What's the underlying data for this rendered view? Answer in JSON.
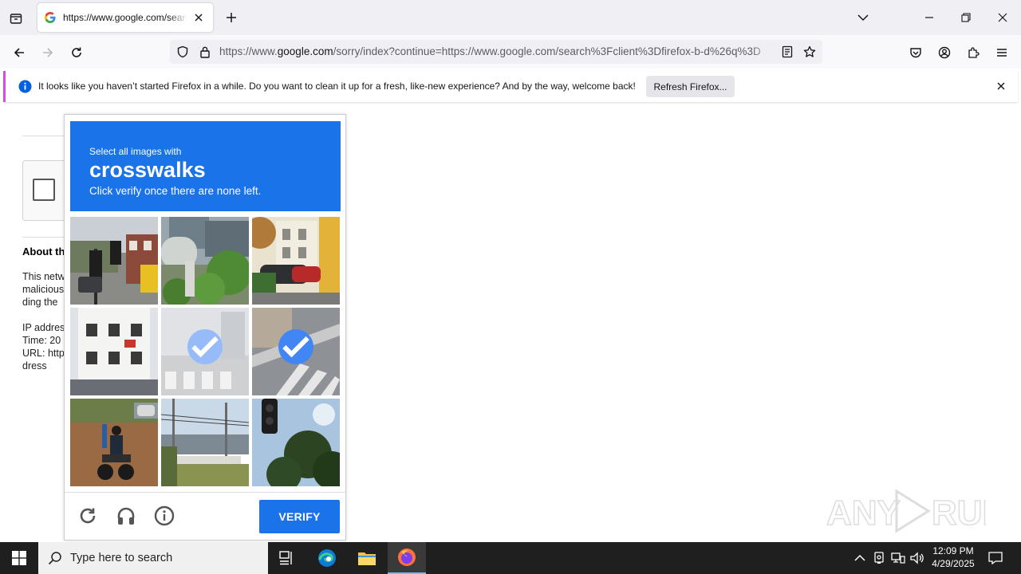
{
  "browser": {
    "tab": {
      "title": "https://www.google.com/search?client=firefox-b-d",
      "favicon": "google-g-icon"
    },
    "url": {
      "prefix": "https://www.",
      "host": "google.com",
      "rest": "/sorry/index?continue=https://www.google.com/search%3Fclient%3Dfirefox-b-d%26q%3D"
    },
    "notification": {
      "text": "It looks like you haven’t started Firefox in a while. Do you want to clean it up for a fresh, like-new experience? And by the way, welcome back!",
      "button": "Refresh Firefox..."
    }
  },
  "page": {
    "about_title": "About th",
    "about_lines": [
      "This netw",
      "malicious",
      "ding the"
    ],
    "info_lines": [
      "IP addres",
      "Time: 20",
      "URL: http",
      "dress"
    ]
  },
  "captcha": {
    "line1": "Select all images with",
    "keyword": "crosswalks",
    "line3": "Click verify once there are none left.",
    "verify_label": "VERIFY",
    "header_color": "#1a73e8",
    "tiles": [
      {
        "subject": "traffic light with brick house and yellow van",
        "selected": false
      },
      {
        "subject": "street with green trees and buildings",
        "selected": false
      },
      {
        "subject": "yellow building with parked red cars",
        "selected": false
      },
      {
        "subject": "white building with windows",
        "selected": false
      },
      {
        "subject": "faded street crosswalk",
        "selected": true
      },
      {
        "subject": "crosswalk stripes on road",
        "selected": true
      },
      {
        "subject": "motorcycle on dirt road",
        "selected": false
      },
      {
        "subject": "bridge and utility poles",
        "selected": false
      },
      {
        "subject": "traffic light against sky and tree",
        "selected": false
      }
    ]
  },
  "watermark": {
    "text": "ANY RUN"
  },
  "taskbar": {
    "search_placeholder": "Type here to search",
    "time": "12:09 PM",
    "date": "4/29/2025"
  }
}
